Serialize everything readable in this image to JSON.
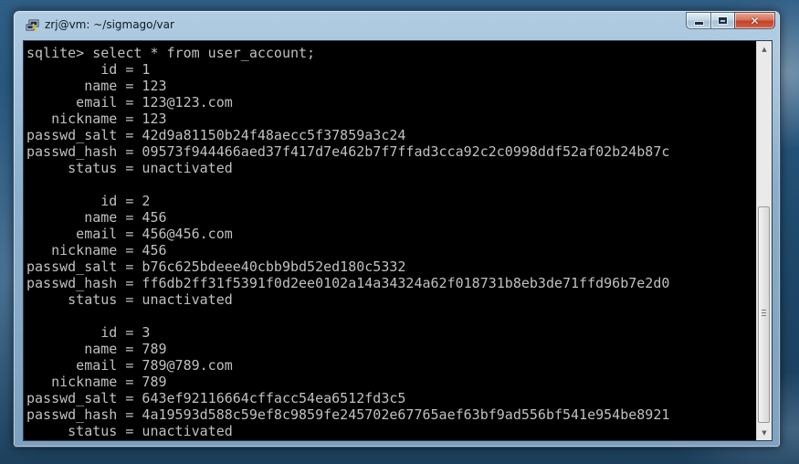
{
  "window": {
    "title": "zrj@vm: ~/sigmago/var",
    "minimize_glyph": "",
    "maximize_glyph": "",
    "close_glyph": "✕"
  },
  "terminal": {
    "lines": [
      "sqlite> select * from user_account;",
      "         id = 1",
      "       name = 123",
      "      email = 123@123.com",
      "   nickname = 123",
      "passwd_salt = 42d9a81150b24f48aecc5f37859a3c24",
      "passwd_hash = 09573f944466aed37f417d7e462b7f7ffad3cca92c2c0998ddf52af02b24b87c",
      "     status = unactivated",
      "",
      "         id = 2",
      "       name = 456",
      "      email = 456@456.com",
      "   nickname = 456",
      "passwd_salt = b76c625bdeee40cbb9bd52ed180c5332",
      "passwd_hash = ff6db2ff31f5391f0d2ee0102a14a34324a62f018731b8eb3de71ffd96b7e2d0",
      "     status = unactivated",
      "",
      "         id = 3",
      "       name = 789",
      "      email = 789@789.com",
      "   nickname = 789",
      "passwd_salt = 643ef92116664cffacc54ea6512fd3c5",
      "passwd_hash = 4a19593d588c59ef8c9859fe245702e67765aef63bf9ad556bf541e954be8921",
      "     status = unactivated"
    ]
  },
  "scrollbar": {
    "up_glyph": "▲",
    "down_glyph": "▼",
    "scroll_position": 1.0
  },
  "icons": {
    "app": "putty-terminal-icon",
    "minimize": "minimize-icon",
    "maximize": "maximize-icon",
    "close": "close-icon"
  },
  "colors": {
    "terminal_background": "#000000",
    "terminal_text": "#c0c0c0",
    "close_button": "#c9452b"
  }
}
